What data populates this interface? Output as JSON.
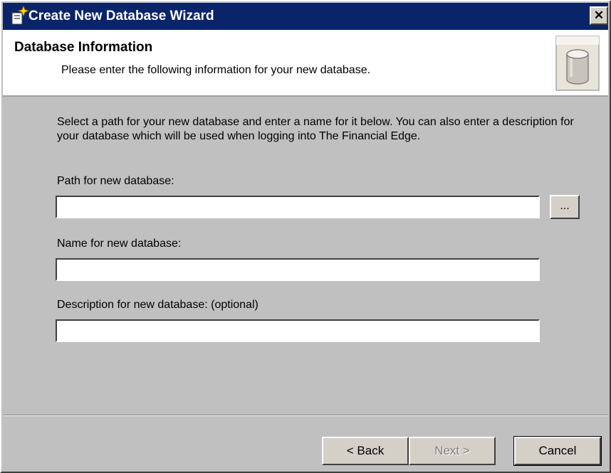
{
  "window": {
    "title": "Create New Database Wizard",
    "close_glyph": "✕",
    "title_icon": "wizard-wand-icon",
    "titlebar_color": "#0a246a"
  },
  "header": {
    "title": "Database Information",
    "subtitle": "Please enter the following information for your new database.",
    "icon": "database-cylinder-icon"
  },
  "body": {
    "description": "Select a path for your new database and enter a name for it below. You can also enter a description for your database which will be used when logging into The Financial Edge."
  },
  "fields": {
    "path": {
      "label": "Path for new database:",
      "value": "",
      "browse_label": "..."
    },
    "name": {
      "label": "Name for new database:",
      "value": ""
    },
    "description": {
      "label": "Description for new database: (optional)",
      "value": ""
    }
  },
  "buttons": {
    "back": "< Back",
    "next": "Next >",
    "cancel": "Cancel"
  }
}
